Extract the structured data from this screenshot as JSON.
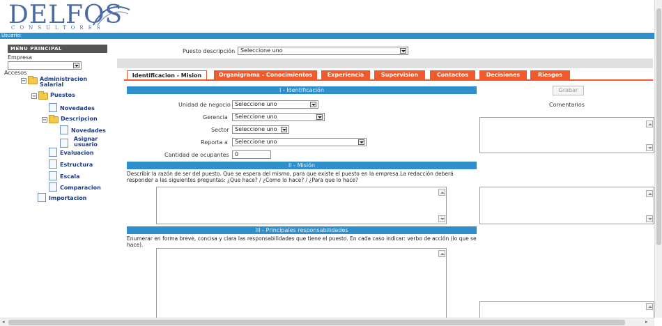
{
  "brand": {
    "name": "DELFOS",
    "tagline": "CONSULTORES"
  },
  "header": {
    "user_label": "Usuario:"
  },
  "sidebar": {
    "menu_title": "MENU PRINCIPAL",
    "empresa_label": "Empresa",
    "empresa_value": "",
    "accesos_label": "Accesos",
    "tree": {
      "administracion": "Administracion Salarial",
      "puestos": "Puestos",
      "novedades": "Novedades",
      "descripcion": "Descripcion",
      "desc_novedades": "Novedades",
      "asignar_usuario": "Asignar usuario",
      "evaluacion": "Evaluacion",
      "estructura": "Estructura",
      "escala": "Escala",
      "comparacion": "Comparacion",
      "importacion": "Importacion"
    }
  },
  "puesto": {
    "label": "Puesto descripción",
    "value": "Seleccione uno"
  },
  "tabs": [
    {
      "label": "Identificacion - Mision",
      "active": true
    },
    {
      "label": "Organigrama - Conocimientos"
    },
    {
      "label": "Experiencia"
    },
    {
      "label": "Supervision"
    },
    {
      "label": "Contactos"
    },
    {
      "label": "Decisiones"
    },
    {
      "label": "Riesgos"
    }
  ],
  "identificacion": {
    "title": "I - Identificación",
    "unidad_label": "Unidad de negocio",
    "unidad_value": "Seleccione uno",
    "gerencia_label": "Gerencia",
    "gerencia_value": "Seleccione uno",
    "sector_label": "Sector",
    "sector_value": "Seleccione uno",
    "reporta_label": "Reporta a",
    "reporta_value": "Seleccione uno",
    "cantidad_label": "Cantidad de ocupantes",
    "cantidad_value": "0"
  },
  "mision": {
    "title": "II - Misión",
    "text": "Describir la razón de ser del puesto. Que se espera del mismo, para que existe el puesto en la empresa.La redacción deberá responder a las siguientes preguntas: ¿Que hace? / ¿Como lo hace? / ¿Para que lo hace?"
  },
  "responsabilidades": {
    "title": "III - Principales responsabilidades",
    "text": "Enumerar en forma breve, concisa y clara las responsabilidades que tiene el puesto. En cada caso indicar: verbo de acción (lo que se hace)."
  },
  "actions": {
    "grabar": "Grabar",
    "comentarios": "Comentarios"
  },
  "colors": {
    "accent_blue": "#2e8fcb",
    "tab_orange": "#f05a2a",
    "tree_text": "#1a3a8a"
  }
}
